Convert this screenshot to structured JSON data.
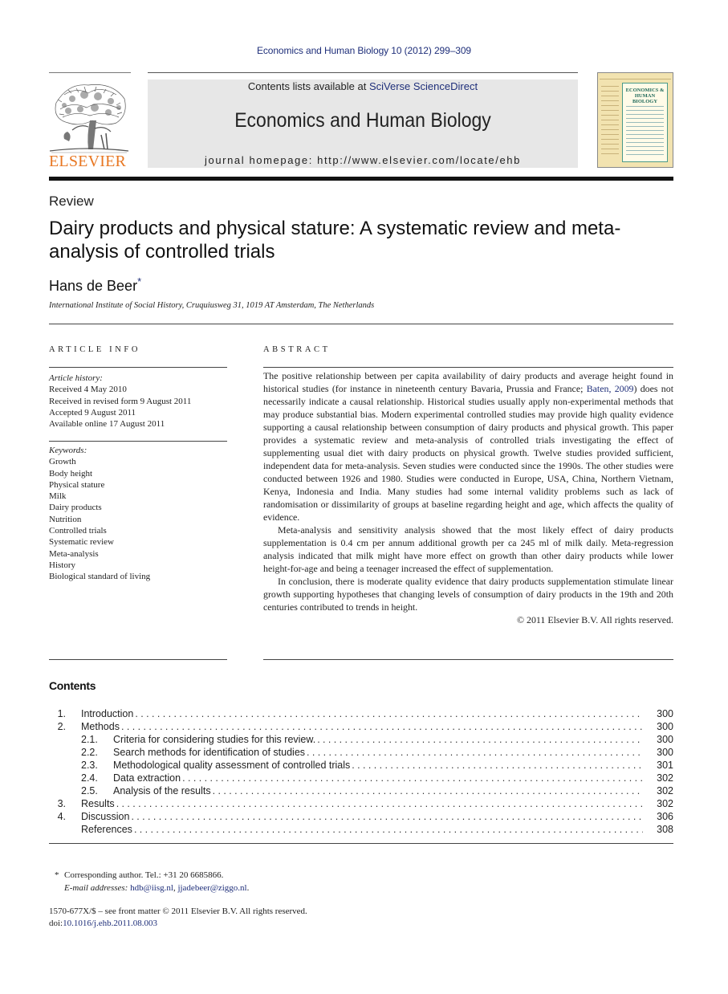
{
  "running_head": "Economics and Human Biology 10 (2012) 299–309",
  "masthead": {
    "publisher_logo_text": "ELSEVIER",
    "contents_prefix": "Contents lists available at ",
    "contents_link": "SciVerse ScienceDirect",
    "journal_title": "Economics and Human Biology",
    "homepage_label": "journal homepage: ",
    "homepage_url": "http://www.elsevier.com/locate/ehb",
    "cover_title": "ECONOMICS & HUMAN BIOLOGY"
  },
  "article": {
    "type": "Review",
    "title": "Dairy products and physical stature: A systematic review and meta-analysis of controlled trials",
    "author": "Hans de Beer",
    "author_mark": "*",
    "affiliation": "International Institute of Social History, Cruquiusweg 31, 1019 AT Amsterdam, The Netherlands"
  },
  "article_info": {
    "heading": "ARTICLE INFO",
    "history_label": "Article history:",
    "history": [
      "Received 4 May 2010",
      "Received in revised form 9 August 2011",
      "Accepted 9 August 2011",
      "Available online 17 August 2011"
    ],
    "keywords_label": "Keywords:",
    "keywords": [
      "Growth",
      "Body height",
      "Physical stature",
      "Milk",
      "Dairy products",
      "Nutrition",
      "Controlled trials",
      "Systematic review",
      "Meta-analysis",
      "History",
      "Biological standard of living"
    ]
  },
  "abstract": {
    "heading": "ABSTRACT",
    "p1_before_link": "The positive relationship between per capita availability of dairy products and average height found in historical studies (for instance in nineteenth century Bavaria, Prussia and France; ",
    "p1_link": "Baten, 2009",
    "p1_after_link": ") does not necessarily indicate a causal relationship. Historical studies usually apply non-experimental methods that may produce substantial bias. Modern experimental controlled studies may provide high quality evidence supporting a causal relationship between consumption of dairy products and physical growth. This paper provides a systematic review and meta-analysis of controlled trials investigating the effect of supplementing usual diet with dairy products on physical growth. Twelve studies provided sufficient, independent data for meta-analysis. Seven studies were conducted since the 1990s. The other studies were conducted between 1926 and 1980. Studies were conducted in Europe, USA, China, Northern Vietnam, Kenya, Indonesia and India. Many studies had some internal validity problems such as lack of randomisation or dissimilarity of groups at baseline regarding height and age, which affects the quality of evidence.",
    "p2": "Meta-analysis and sensitivity analysis showed that the most likely effect of dairy products supplementation is 0.4 cm per annum additional growth per ca 245 ml of milk daily. Meta-regression analysis indicated that milk might have more effect on growth than other dairy products while lower height-for-age and being a teenager increased the effect of supplementation.",
    "p3": "In conclusion, there is moderate quality evidence that dairy products supplementation stimulate linear growth supporting hypotheses that changing levels of consumption of dairy products in the 19th and 20th centuries contributed to trends in height.",
    "copyright": "© 2011 Elsevier B.V. All rights reserved."
  },
  "contents": {
    "heading": "Contents",
    "items": [
      {
        "num": "1.",
        "label": "Introduction",
        "page": "300",
        "level": 1
      },
      {
        "num": "2.",
        "label": "Methods",
        "page": "300",
        "level": 1
      },
      {
        "num": "2.1.",
        "label": "Criteria for considering studies for this review.",
        "page": "300",
        "level": 2
      },
      {
        "num": "2.2.",
        "label": "Search methods for identification of studies",
        "page": "300",
        "level": 2
      },
      {
        "num": "2.3.",
        "label": "Methodological quality assessment of controlled trials",
        "page": "301",
        "level": 2
      },
      {
        "num": "2.4.",
        "label": "Data extraction",
        "page": "302",
        "level": 2
      },
      {
        "num": "2.5.",
        "label": "Analysis of the results",
        "page": "302",
        "level": 2
      },
      {
        "num": "3.",
        "label": "Results",
        "page": "302",
        "level": 1
      },
      {
        "num": "4.",
        "label": "Discussion",
        "page": "306",
        "level": 1
      },
      {
        "num": "",
        "label": "References",
        "page": "308",
        "level": 1
      }
    ]
  },
  "footnote": {
    "mark": "*",
    "corresponding": "Corresponding author. Tel.: +31 20 6685866.",
    "email_label": "E-mail addresses:",
    "emails": [
      "hdb@iisg.nl",
      "jjadebeer@ziggo.nl"
    ]
  },
  "front_matter": {
    "issn_line": "1570-677X/$ – see front matter © 2011 Elsevier B.V. All rights reserved.",
    "doi_prefix": "doi:",
    "doi": "10.1016/j.ehb.2011.08.003"
  },
  "colors": {
    "link": "#1f2f7a",
    "elsevier_orange": "#e87722",
    "masthead_gray": "#e7e7e7"
  }
}
